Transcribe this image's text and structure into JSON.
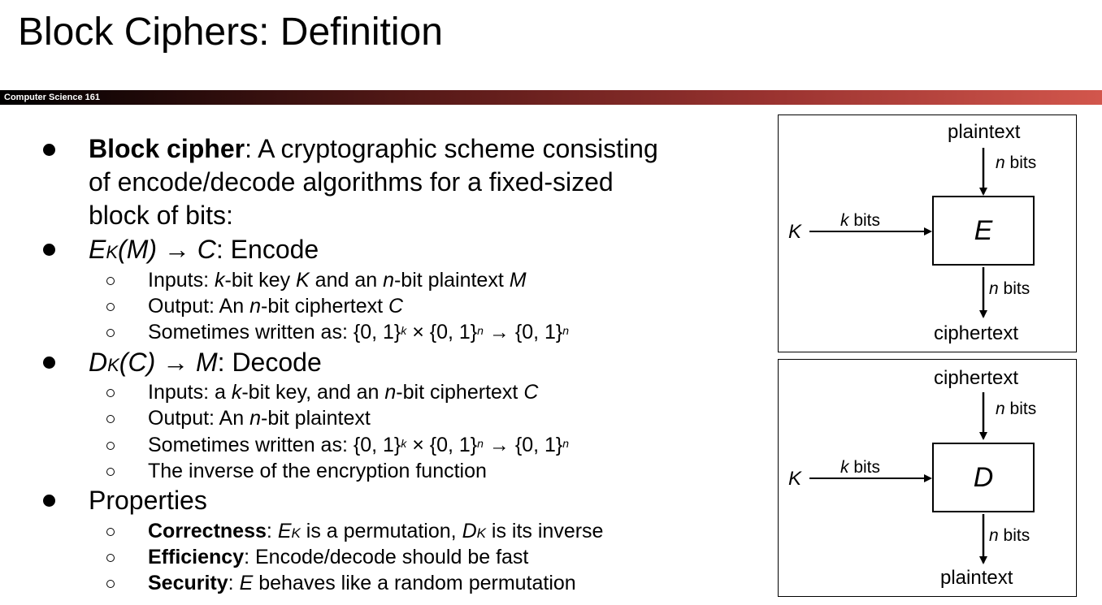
{
  "slide": {
    "title": "Block Ciphers: Definition",
    "course_label": "Computer Science 161"
  },
  "bullets": {
    "block_cipher": {
      "term": "Block cipher",
      "line1_rest": ": A cryptographic scheme consisting",
      "line2": "of encode/decode algorithms for a fixed-sized",
      "line3": "block of bits:"
    },
    "encode": {
      "E": "E",
      "sub": "K",
      "arg": "(M) → C",
      "label": ": Encode",
      "items": {
        "i1": {
          "a": "Inputs: ",
          "b": "k",
          "c": "-bit key ",
          "d": "K",
          "e": " and an ",
          "f": "n",
          "g": "-bit plaintext ",
          "h": "M"
        },
        "i2": {
          "a": "Output: An ",
          "b": "n",
          "c": "-bit ciphertext ",
          "d": "C"
        },
        "i3": {
          "a": "Sometimes written as: {0, 1}",
          "b": "k",
          "c": " × {0, 1}",
          "d": "n",
          "e": " → {0, 1}",
          "f": "n"
        }
      }
    },
    "decode": {
      "D": "D",
      "sub": "K",
      "arg": "(C) → M",
      "label": ": Decode",
      "items": {
        "i1": {
          "a": "Inputs: a ",
          "b": "k",
          "c": "-bit key, and an ",
          "d": "n",
          "e": "-bit ciphertext ",
          "f": "C"
        },
        "i2": {
          "a": "Output: An ",
          "b": "n",
          "c": "-bit plaintext"
        },
        "i3": {
          "a": "Sometimes written as: {0, 1}",
          "b": "k",
          "c": " × {0, 1}",
          "d": "n",
          "e": " → {0, 1}",
          "f": "n"
        },
        "i4": {
          "a": "The inverse of the encryption function"
        }
      }
    },
    "properties": {
      "label": "Properties",
      "correctness": {
        "term": "Correctness",
        "a": ": ",
        "E": "E",
        "Esub": "K",
        "b": " is a permutation, ",
        "D": "D",
        "Dsub": "K",
        "c": " is its inverse"
      },
      "efficiency": {
        "term": "Efficiency",
        "a": ": Encode/decode should be fast"
      },
      "security": {
        "term": "Security",
        "a": ": ",
        "E": "E",
        "b": " behaves like a random permutation"
      }
    }
  },
  "diagrams": {
    "encrypt": {
      "top_label": "plaintext",
      "top_bits_n": "n",
      "top_bits_unit": " bits",
      "key": "K",
      "key_bits_k": "k",
      "key_bits_unit": " bits",
      "box": "E",
      "bottom_bits_n": "n",
      "bottom_bits_unit": " bits",
      "bottom_label": "ciphertext"
    },
    "decrypt": {
      "top_label": "ciphertext",
      "top_bits_n": "n",
      "top_bits_unit": " bits",
      "key": "K",
      "key_bits_k": "k",
      "key_bits_unit": " bits",
      "box": "D",
      "bottom_bits_n": "n",
      "bottom_bits_unit": " bits",
      "bottom_label": "plaintext"
    }
  }
}
